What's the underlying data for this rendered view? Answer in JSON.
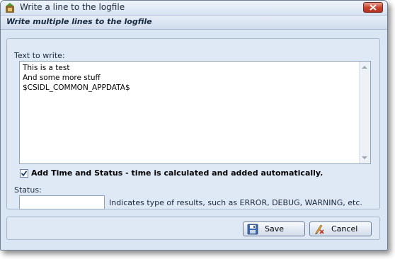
{
  "window": {
    "title": "Write a line to the logfile",
    "subheader": "Write multiple lines to the logfile"
  },
  "form": {
    "text_label": "Text to write:",
    "text_lines": [
      "This is a test",
      "And some more stuff",
      "$CSIDL_COMMON_APPDATA$"
    ],
    "add_time_checked": true,
    "add_time_label": "Add Time and Status - time is calculated and added automatically.",
    "status_label": "Status:",
    "status_value": "",
    "status_hint": "Indicates type of results, such as ERROR, DEBUG, WARNING, etc."
  },
  "buttons": {
    "save_label": "Save",
    "cancel_label": "Cancel"
  },
  "icons": {
    "app": "app-icon",
    "close": "close-icon",
    "save": "floppy-disk-icon",
    "cancel": "cancel-icon",
    "check": "checkmark-icon"
  },
  "colors": {
    "window_bg": "#dbe6f4",
    "close_button": "#c8432e"
  }
}
